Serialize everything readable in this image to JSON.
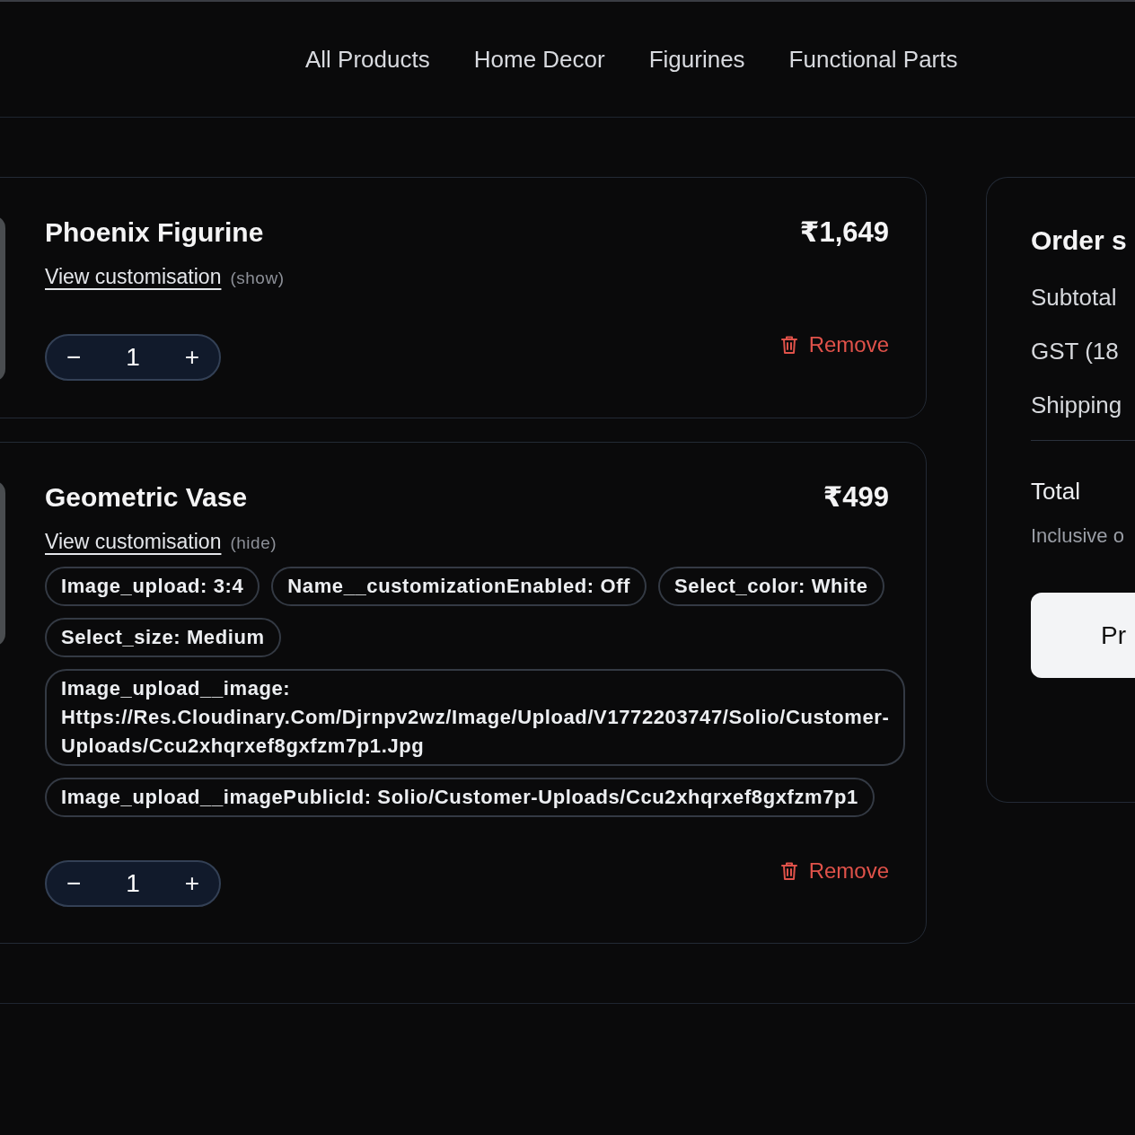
{
  "nav": {
    "links": [
      "All Products",
      "Home Decor",
      "Figurines",
      "Functional Parts"
    ]
  },
  "cart_items": [
    {
      "title": "Phoenix Figurine",
      "price": "₹1,649",
      "customisation": {
        "link": "View customisation",
        "toggle": "(show)"
      },
      "decrement": "−",
      "quantity": "1",
      "increment": "+",
      "remove": "Remove"
    },
    {
      "title": "Geometric Vase",
      "price": "₹499",
      "customisation": {
        "link": "View customisation",
        "toggle": "(hide)",
        "details": [
          "Image_upload: 3:4",
          "Name__customizationEnabled: Off",
          "Select_color: White",
          "Select_size: Medium",
          "Image_upload__image: Https://Res.Cloudinary.Com/Djrnpv2wz/Image/Upload/V1772203747/Solio/Customer-Uploads/Ccu2xhqrxef8gxfzm7p1.Jpg",
          "Image_upload__imagePublicId: Solio/Customer-Uploads/Ccu2xhqrxef8gxfzm7p1"
        ]
      },
      "decrement": "−",
      "quantity": "1",
      "increment": "+",
      "remove": "Remove"
    }
  ],
  "summary": {
    "title": "Order s",
    "rows": [
      "Subtotal",
      "GST (18",
      "Shipping"
    ],
    "total": "Total",
    "note": "Inclusive o",
    "button": "Pr"
  }
}
